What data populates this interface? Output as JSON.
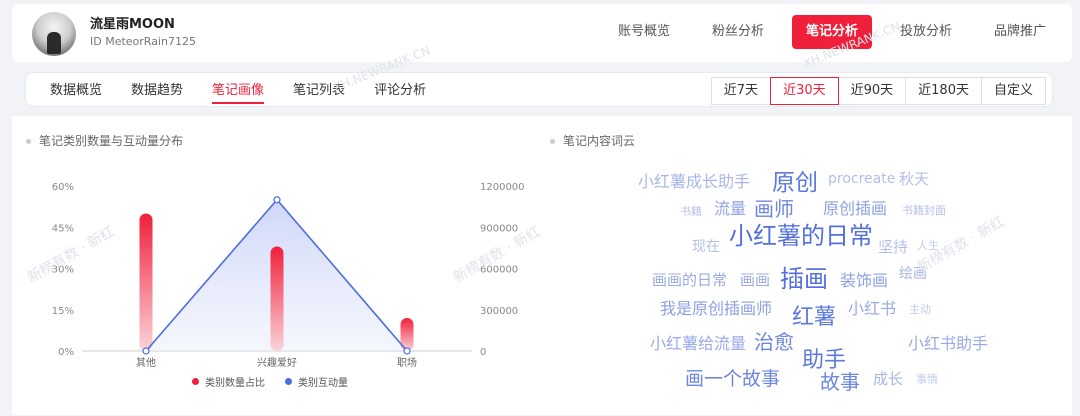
{
  "profile": {
    "name": "流星雨MOON",
    "id_label": "ID",
    "id_value": "MeteorRain7125"
  },
  "main_tabs": [
    {
      "label": "账号概览"
    },
    {
      "label": "粉丝分析"
    },
    {
      "label": "笔记分析"
    },
    {
      "label": "投放分析"
    },
    {
      "label": "品牌推广"
    }
  ],
  "sub_tabs": [
    {
      "label": "数据概览"
    },
    {
      "label": "数据趋势"
    },
    {
      "label": "笔记画像"
    },
    {
      "label": "笔记列表"
    },
    {
      "label": "评论分析"
    }
  ],
  "date_ranges": [
    {
      "label": "近7天"
    },
    {
      "label": "近30天"
    },
    {
      "label": "近90天"
    },
    {
      "label": "近180天"
    },
    {
      "label": "自定义"
    }
  ],
  "sections": {
    "left_title": "笔记类别数量与互动量分布",
    "right_title": "笔记内容词云"
  },
  "watermarks": {
    "site": "XH.NEWRANK.CN",
    "brand": "新榜有数 · 新红"
  },
  "colors": {
    "accent": "#f0203b",
    "series_count": "#f0203b",
    "series_interact": "#4a6ee0"
  },
  "chart_data": {
    "type": "bar",
    "categories": [
      "其他",
      "兴趣爱好",
      "职场"
    ],
    "series": [
      {
        "name": "类别数量占比",
        "type": "bar",
        "axis": "left",
        "values": [
          50,
          38,
          12
        ]
      },
      {
        "name": "类别互动量",
        "type": "line",
        "axis": "right",
        "values": [
          0,
          1100000,
          0
        ]
      }
    ],
    "y_left": {
      "ticks": [
        "0%",
        "15%",
        "30%",
        "45%",
        "60%"
      ],
      "range": [
        0,
        60
      ]
    },
    "y_right": {
      "ticks": [
        "0",
        "300000",
        "600000",
        "900000",
        "1200000"
      ],
      "range": [
        0,
        1200000
      ]
    },
    "legend": "bottom"
  },
  "word_cloud": [
    {
      "text": "小红薯成长助手",
      "size": 16,
      "color": "#a9b6e6"
    },
    {
      "text": "原创",
      "size": 23,
      "color": "#5d78de"
    },
    {
      "text": "procreate",
      "size": 14,
      "color": "#b3bfe9"
    },
    {
      "text": "秋天",
      "size": 15,
      "color": "#b3bfe9"
    },
    {
      "text": "书籍",
      "size": 11,
      "color": "#b6c1ea"
    },
    {
      "text": "流量",
      "size": 16,
      "color": "#8ea0e3"
    },
    {
      "text": "画师",
      "size": 20,
      "color": "#6d86e0"
    },
    {
      "text": "原创插画",
      "size": 16,
      "color": "#8ea0e3"
    },
    {
      "text": "书籍封面",
      "size": 11,
      "color": "#b6c1ea"
    },
    {
      "text": "小红薯的日常",
      "size": 24,
      "color": "#5470dc"
    },
    {
      "text": "现在",
      "size": 14,
      "color": "#b3bfe9"
    },
    {
      "text": "坚持",
      "size": 15,
      "color": "#b3bfe9"
    },
    {
      "text": "人生",
      "size": 11,
      "color": "#c3ccee"
    },
    {
      "text": "画画的日常",
      "size": 15,
      "color": "#9aaae5"
    },
    {
      "text": "画画",
      "size": 15,
      "color": "#9aaae5"
    },
    {
      "text": "插画",
      "size": 24,
      "color": "#5470dc"
    },
    {
      "text": "装饰画",
      "size": 16,
      "color": "#8ea0e3"
    },
    {
      "text": "绘画",
      "size": 14,
      "color": "#a9b6e6"
    },
    {
      "text": "我是原创插画师",
      "size": 16,
      "color": "#8ea0e3"
    },
    {
      "text": "小红书",
      "size": 16,
      "color": "#9aaae5"
    },
    {
      "text": "主动",
      "size": 11,
      "color": "#c3ccee"
    },
    {
      "text": "红薯",
      "size": 22,
      "color": "#5d78de"
    },
    {
      "text": "小红薯给流量",
      "size": 16,
      "color": "#9aaae5"
    },
    {
      "text": "治愈",
      "size": 20,
      "color": "#6d86e0"
    },
    {
      "text": "小红书助手",
      "size": 16,
      "color": "#9aaae5"
    },
    {
      "text": "助手",
      "size": 22,
      "color": "#5d78de"
    },
    {
      "text": "画一个故事",
      "size": 19,
      "color": "#6d86e0"
    },
    {
      "text": "故事",
      "size": 20,
      "color": "#6d86e0"
    },
    {
      "text": "成长",
      "size": 15,
      "color": "#a9b6e6"
    },
    {
      "text": "事情",
      "size": 11,
      "color": "#c3ccee"
    }
  ]
}
